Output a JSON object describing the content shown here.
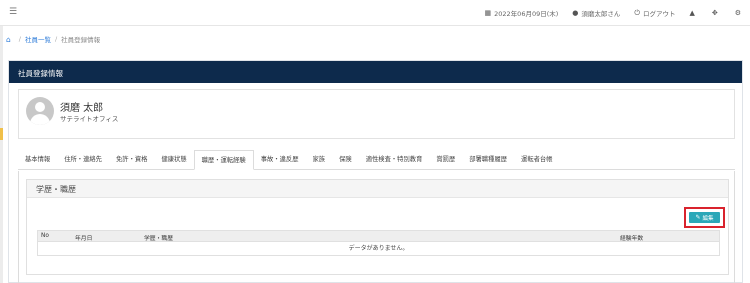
{
  "topbar": {
    "date": "2022年06月09日(木)",
    "user": "須磨太郎さん",
    "logout": "ログアウト"
  },
  "breadcrumb": {
    "items": [
      "社員一覧",
      "社員登録情報"
    ]
  },
  "panel": {
    "title": "社員登録情報"
  },
  "profile": {
    "name": "須磨 太郎",
    "office": "サテライトオフィス"
  },
  "tabs": [
    "基本情報",
    "住所・連絡先",
    "免許・資格",
    "健康状態",
    "職歴・運転経験",
    "事故・違反歴",
    "家族",
    "保険",
    "適性検査・特別教育",
    "賞罰歴",
    "部署職種履歴",
    "運転者台帳"
  ],
  "active_tab": 4,
  "section": {
    "title": "学歴・職歴",
    "edit_label": "編集",
    "columns": [
      "No",
      "年月日",
      "学歴・職歴",
      "経験年数"
    ],
    "empty_text": "データがありません。"
  },
  "icons": [
    "menu-icon",
    "calendar-icon",
    "user-icon",
    "power-icon",
    "bell-icon",
    "fullscreen-icon",
    "gears-icon",
    "home-icon",
    "avatar-icon",
    "edit-icon"
  ],
  "colors": {
    "header": "#0d2a4c",
    "edit_button": "#2aa7b8",
    "highlight": "#d9232d",
    "link": "#2c7bd9"
  }
}
